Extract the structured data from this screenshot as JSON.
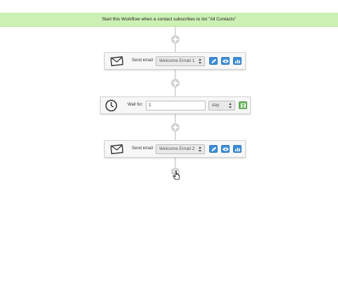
{
  "trigger": {
    "text": "Start this Workflow when a contact subscribes to list \"All Contacts\""
  },
  "steps": [
    {
      "type": "send_email",
      "icon": "envelope-icon",
      "label": "Send email",
      "selected_email": "Welcome Email 1",
      "buttons": [
        "edit-pencil-icon",
        "preview-eye-icon",
        "stats-chart-icon"
      ]
    },
    {
      "type": "wait",
      "icon": "clock-icon",
      "label": "Wait for:",
      "value": "1",
      "unit": "day",
      "buttons": [
        "save-icon"
      ]
    },
    {
      "type": "send_email",
      "icon": "envelope-icon",
      "label": "Send email",
      "selected_email": "Welcome Email 2",
      "buttons": [
        "edit-pencil-icon",
        "preview-eye-icon",
        "stats-chart-icon"
      ]
    }
  ],
  "add_step_icon": "plus-circle-icon",
  "cursor_icon": "hand-pointer-icon",
  "colors": {
    "trigger_bg": "#cdf0b4",
    "action_blue": "#3d8fd8",
    "save_green": "#6bb35f",
    "connector": "#dcdcdc"
  }
}
